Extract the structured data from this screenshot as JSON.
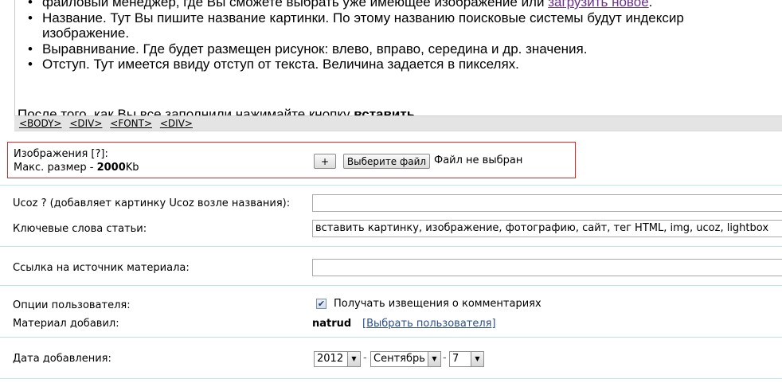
{
  "editor": {
    "items": [
      {
        "lines": [
          "файловый менеджер, где Вы сможете выбрать уже имеющее изображение или "
        ],
        "link": "загрузить новое",
        "link_suffix": "."
      },
      {
        "lines": [
          "Название. Тут Вы пишите название картинки. По этому названию поисковые системы будут индексир",
          "изображение."
        ]
      },
      {
        "lines": [
          "Выравнивание. Где будет размещен рисунок: влево, вправо, середина и др. значения."
        ]
      },
      {
        "lines": [
          "Отступ. Тут имеется ввиду отступ от текста. Величина задается в пикселях."
        ]
      }
    ],
    "after_text": "После того, как Вы все заполнили нажимайте кнопку ",
    "after_bold": "вставить"
  },
  "tagbar": {
    "tags": [
      "<BODY>",
      "<DIV>",
      "<FONT>",
      "<DIV>"
    ]
  },
  "form": {
    "upload": {
      "label": "Изображения [?]:",
      "max_size_prefix": "Макс. размер - ",
      "max_size_value": "2000",
      "max_size_unit": "Kb",
      "add_button": "+",
      "choose_button": "Выберите файл",
      "file_status": "Файл не выбран"
    },
    "ucoz": {
      "label": "Ucoz ? (добавляет картинку Ucoz возле названия):",
      "value": ""
    },
    "keywords": {
      "label": "Ключевые слова статьи:",
      "value": "вставить картинку, изображение, фотографию, сайт, тег HTML, img, ucoz, lightbox"
    },
    "source": {
      "label": "Ссылка на источник материала:",
      "value": ""
    },
    "user_options": {
      "label": "Опции пользователя:",
      "checkbox_label": "Получать извещения о комментариях",
      "checked": true
    },
    "added_by": {
      "label": "Материал добавил:",
      "user": "natrud",
      "bracket_open": "[",
      "select_user_link": "Выбрать пользователя",
      "bracket_close": "]"
    },
    "date": {
      "label": "Дата добавления:",
      "year": "2012",
      "month": "Сентябрь",
      "day": "7",
      "separator": "-"
    }
  }
}
